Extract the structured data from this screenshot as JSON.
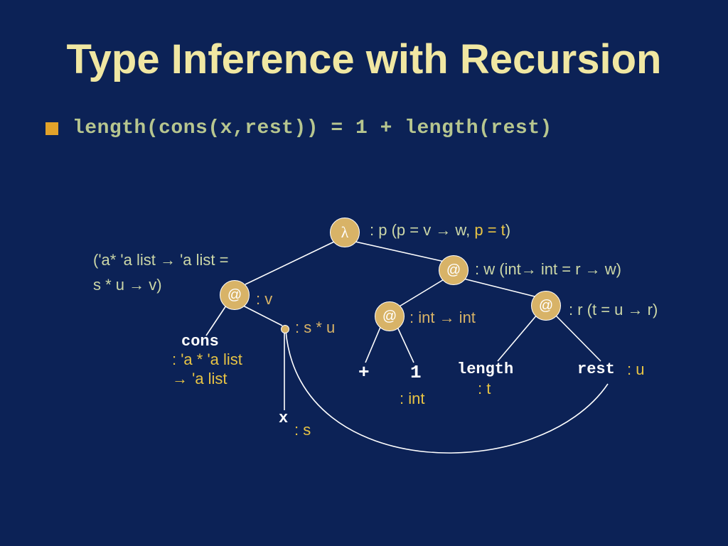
{
  "title": "Type Inference with Recursion",
  "equation": "length(cons(x,rest)) = 1 + length(rest)",
  "nodes": {
    "lambda": {
      "glyph": "λ"
    },
    "at1": {
      "glyph": "@"
    },
    "at2": {
      "glyph": "@"
    },
    "at3": {
      "glyph": "@"
    },
    "at4": {
      "glyph": "@"
    }
  },
  "labels": {
    "lambda_ann_prefix": ": p  (p = v → w, ",
    "lambda_ann_highlight": "p = t",
    "lambda_ann_suffix": ")",
    "precond1": "('a* 'a list → 'a list =",
    "precond2": "s * u → v)",
    "at1_type": ": v",
    "at2_type": ": w  (int→ int = r → w)",
    "at4_type": ": r  (t = u → r)",
    "at3_type": ": int → int",
    "pair_type": ": s * u",
    "cons": "cons",
    "cons_type1": ": 'a * 'a list",
    "cons_type2": "→ 'a list",
    "x": "x",
    "x_type": ": s",
    "plus": "+",
    "one": "1",
    "int_type": ": int",
    "length": "length",
    "length_type": ": t",
    "rest": "rest",
    "rest_type": ": u"
  }
}
